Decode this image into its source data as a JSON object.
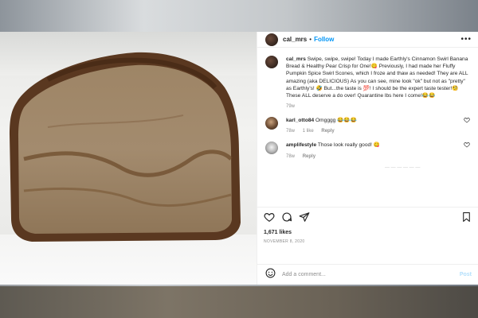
{
  "header": {
    "username": "cal_mrs",
    "separator": "•",
    "follow_label": "Follow",
    "more_label": "•••"
  },
  "caption": {
    "username": "cal_mrs",
    "text": "Swipe, swipe, swipe! Today I made Earthly's Cinnamon Swirl Banana Bread & Healthy Pear Crisp for One!😋 Previously, I had made her Fluffy Pumpkin Spice Swirl Scones, which I froze and thaw as needed! They are ALL amazing (aka DELICIOUS) As you can see, mine look \"ok\" but not as \"pretty\" as Earthly's! 🤣 But...the taste is 💯! I should be the expert taste tester!🧐 These ALL deserve a do over! Quarantine lbs here I come!😂😂",
    "age": "79w"
  },
  "comments": [
    {
      "username": "karl_otto84",
      "text": "Omgggg 😂😂😂",
      "age": "78w",
      "likes": "1 like",
      "reply_label": "Reply"
    },
    {
      "username": "amplifestyle",
      "text": "Those look really good! 😋",
      "age": "78w",
      "likes": "",
      "reply_label": "Reply"
    }
  ],
  "faded_line": "— — — — — —",
  "actions": {
    "likes_count": "1,671 likes",
    "date": "NOVEMBER 8, 2020",
    "icons": [
      "heart-icon",
      "comment-icon",
      "share-icon",
      "bookmark-icon"
    ]
  },
  "composer": {
    "placeholder": "Add a comment...",
    "post_label": "Post"
  },
  "colors": {
    "follow": "#0095f6",
    "post_disabled": "#b2dffc",
    "muted": "#8e8e8e",
    "text": "#262626"
  }
}
